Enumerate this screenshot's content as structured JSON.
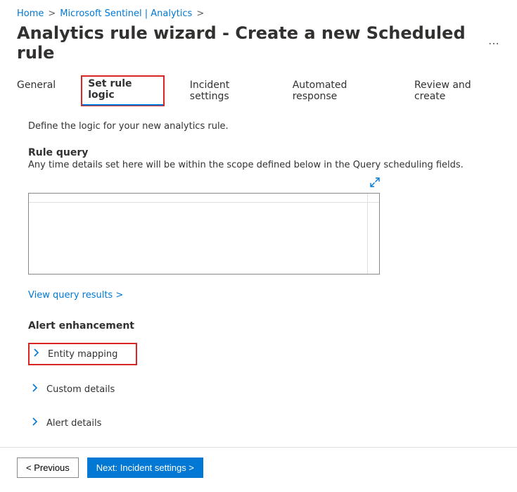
{
  "breadcrumb": {
    "home": "Home",
    "path": "Microsoft Sentinel | Analytics"
  },
  "title": "Analytics rule wizard - Create a new Scheduled rule",
  "tabs": {
    "general": "General",
    "setRuleLogic": "Set rule logic",
    "incidentSettings": "Incident settings",
    "automatedResponse": "Automated response",
    "reviewCreate": "Review and create"
  },
  "content": {
    "intro": "Define the logic for your new analytics rule.",
    "ruleQuery": {
      "heading": "Rule query",
      "sub": "Any time details set here will be within the scope defined below in the Query scheduling fields."
    },
    "viewResultsLink": "View query results >",
    "alertEnhancement": {
      "heading": "Alert enhancement",
      "entityMapping": "Entity mapping",
      "customDetails": "Custom details",
      "alertDetails": "Alert details"
    }
  },
  "footer": {
    "previous": "< Previous",
    "next": "Next: Incident settings >"
  }
}
